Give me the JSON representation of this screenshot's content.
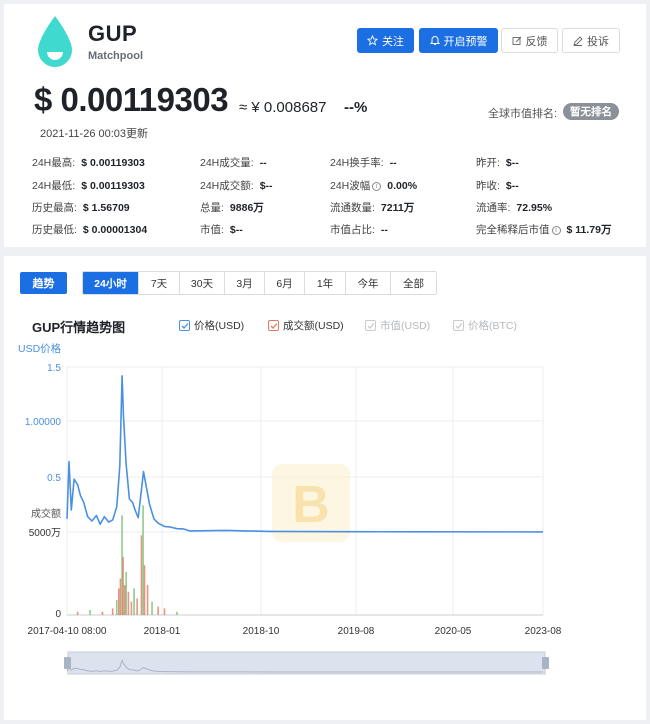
{
  "coin": {
    "symbol": "GUP",
    "name": "Matchpool",
    "price_usd": "$ 0.00119303",
    "price_cny": "≈ ¥ 0.008687",
    "change": "--%",
    "updated": "2021-11-26 00:03更新",
    "rank_label": "全球市值排名:",
    "rank_value": "暂无排名"
  },
  "actions": {
    "follow": "关注",
    "alert": "开启预警",
    "feedback": "反馈",
    "complaint": "投诉"
  },
  "stats": [
    [
      {
        "label": "24H最高:",
        "value": "$ 0.00119303"
      },
      {
        "label": "24H成交量:",
        "value": "--"
      },
      {
        "label": "24H换手率:",
        "value": "--"
      },
      {
        "label": "昨开:",
        "value": "$--"
      }
    ],
    [
      {
        "label": "24H最低:",
        "value": "$ 0.00119303"
      },
      {
        "label": "24H成交额:",
        "value": "$--"
      },
      {
        "label": "24H波幅",
        "value": "0.00%",
        "info": "ⓘ"
      },
      {
        "label": "昨收:",
        "value": "$--"
      }
    ],
    [
      {
        "label": "历史最高:",
        "value": "$ 1.56709"
      },
      {
        "label": "总量:",
        "value": "9886万"
      },
      {
        "label": "流通数量:",
        "value": "7211万"
      },
      {
        "label": "流通率:",
        "value": "72.95%"
      }
    ],
    [
      {
        "label": "历史最低:",
        "value": "$ 0.00001304"
      },
      {
        "label": "市值:",
        "value": "$--"
      },
      {
        "label": "市值占比:",
        "value": "--"
      },
      {
        "label": "完全稀释后市值",
        "value": "$ 11.79万",
        "info": "ⓘ"
      }
    ]
  ],
  "chart_controls": {
    "trend": "趋势",
    "tabs": [
      "24小时",
      "7天",
      "30天",
      "3月",
      "6月",
      "1年",
      "今年",
      "全部"
    ],
    "active_tab": "24小时"
  },
  "chart_data": {
    "type": "line",
    "title": "GUP行情趋势图",
    "legend": [
      {
        "name": "价格(USD)",
        "checked": true,
        "color": "#4a90e2"
      },
      {
        "name": "成交额(USD)",
        "checked": true,
        "color": "#e07a62"
      },
      {
        "name": "市值(USD)",
        "checked": false,
        "color": "#c8cbd0"
      },
      {
        "name": "价格(BTC)",
        "checked": false,
        "color": "#c8cbd0"
      }
    ],
    "ylabel": "USD价格",
    "y_ticks": [
      "1.5",
      "1.00000",
      "0.5"
    ],
    "volume_label": "成交额",
    "volume_ticks": [
      "5000万",
      "0"
    ],
    "x_ticks": [
      "2017-04-10 08:00",
      "2018-01",
      "2018-10",
      "2019-08",
      "2020-05",
      "2023-08"
    ],
    "ylim": [
      0,
      1.5
    ],
    "price_series": {
      "name": "价格(USD)",
      "points": [
        [
          "2017-04-10",
          0.12
        ],
        [
          "2017-04-20",
          0.64
        ],
        [
          "2017-05-01",
          0.2
        ],
        [
          "2017-05-15",
          0.48
        ],
        [
          "2017-06-01",
          0.43
        ],
        [
          "2017-06-15",
          0.33
        ],
        [
          "2017-07-01",
          0.27
        ],
        [
          "2017-07-20",
          0.14
        ],
        [
          "2017-08-10",
          0.1
        ],
        [
          "2017-09-01",
          0.15
        ],
        [
          "2017-09-20",
          0.07
        ],
        [
          "2017-10-10",
          0.14
        ],
        [
          "2017-11-01",
          0.09
        ],
        [
          "2017-11-20",
          0.11
        ],
        [
          "2017-12-10",
          0.23
        ],
        [
          "2017-12-25",
          0.6
        ],
        [
          "2018-01-05",
          1.42
        ],
        [
          "2018-01-12",
          1.05
        ],
        [
          "2018-01-25",
          0.62
        ],
        [
          "2018-02-10",
          0.3
        ],
        [
          "2018-02-25",
          0.27
        ],
        [
          "2018-03-10",
          0.2
        ],
        [
          "2018-03-25",
          0.13
        ],
        [
          "2018-04-10",
          0.38
        ],
        [
          "2018-04-20",
          0.55
        ],
        [
          "2018-05-05",
          0.4
        ],
        [
          "2018-05-20",
          0.25
        ],
        [
          "2018-06-10",
          0.12
        ],
        [
          "2018-07-01",
          0.08
        ],
        [
          "2018-08-01",
          0.05
        ],
        [
          "2018-09-01",
          0.045
        ],
        [
          "2018-10-01",
          0.03
        ],
        [
          "2018-11-01",
          0.028
        ],
        [
          "2018-12-01",
          0.01
        ],
        [
          "2019-03-01",
          0.012
        ],
        [
          "2019-06-01",
          0.015
        ],
        [
          "2019-09-01",
          0.01
        ],
        [
          "2020-01-01",
          0.005
        ],
        [
          "2021-01-01",
          0.003
        ],
        [
          "2022-01-01",
          0.002
        ],
        [
          "2023-08-31",
          0.0012
        ]
      ]
    },
    "volume_series": {
      "name": "成交额(USD)",
      "points": [
        [
          "2017-06-01",
          2000000
        ],
        [
          "2017-08-01",
          3000000
        ],
        [
          "2017-10-01",
          2000000
        ],
        [
          "2017-11-20",
          4000000
        ],
        [
          "2017-12-10",
          9000000
        ],
        [
          "2017-12-20",
          16000000
        ],
        [
          "2017-12-28",
          22000000
        ],
        [
          "2018-01-05",
          60000000
        ],
        [
          "2018-01-10",
          35000000
        ],
        [
          "2018-01-18",
          18000000
        ],
        [
          "2018-01-25",
          26000000
        ],
        [
          "2018-02-05",
          14000000
        ],
        [
          "2018-02-20",
          8000000
        ],
        [
          "2018-03-05",
          16000000
        ],
        [
          "2018-03-20",
          10000000
        ],
        [
          "2018-04-10",
          48000000
        ],
        [
          "2018-04-18",
          66000000
        ],
        [
          "2018-04-25",
          30000000
        ],
        [
          "2018-05-10",
          18000000
        ],
        [
          "2018-06-01",
          8000000
        ],
        [
          "2018-07-01",
          5000000
        ],
        [
          "2018-08-01",
          4000000
        ],
        [
          "2018-10-01",
          2000000
        ]
      ]
    },
    "watermark": "B"
  }
}
